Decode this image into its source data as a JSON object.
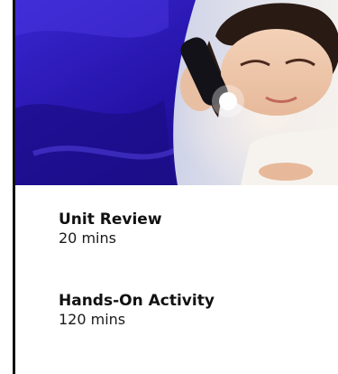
{
  "activities": [
    {
      "title": "Unit Review",
      "duration": "20 mins"
    },
    {
      "title": "Hands-On Activity",
      "duration": "120 mins"
    }
  ],
  "colors": {
    "hero_background": "#2a1ca8",
    "text_primary": "#111111",
    "card_border": "#111111"
  }
}
